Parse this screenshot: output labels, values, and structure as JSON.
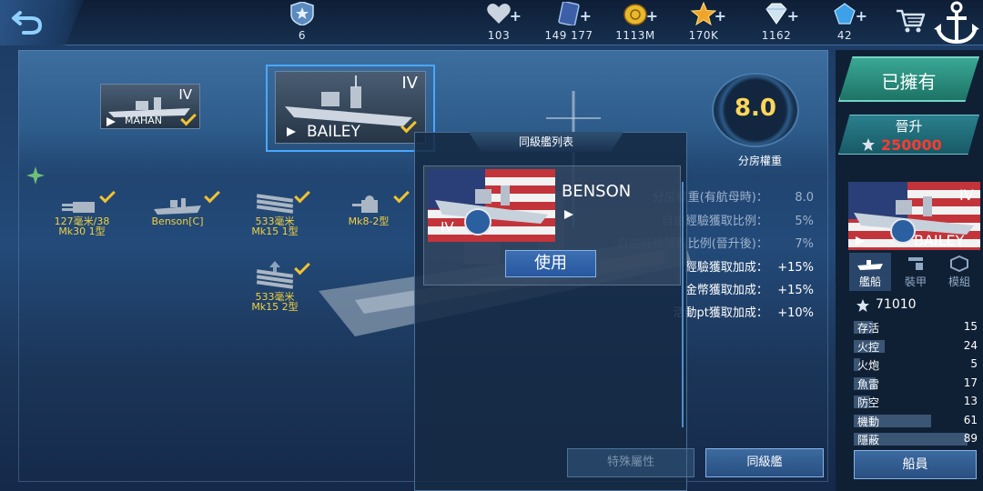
{
  "topbar": {
    "rank": {
      "icon": "rank-badge-icon",
      "value": "6"
    },
    "resources": [
      {
        "icon": "heart-icon",
        "value": "103",
        "color": "#c9d4e0"
      },
      {
        "icon": "card-icon",
        "value": "149 177",
        "color": "#3d5fa8"
      },
      {
        "icon": "gold-coin-icon",
        "value": "1113M",
        "color": "#e8b92c"
      },
      {
        "icon": "star-icon",
        "value": "170K",
        "color": "#f0a52a"
      },
      {
        "icon": "diamond-icon",
        "value": "1162",
        "color": "#cfe3f3"
      },
      {
        "icon": "blue-crystal-icon",
        "value": "42",
        "color": "#3ea0e8"
      }
    ]
  },
  "fleet": {
    "ships": [
      {
        "name": "MAHAN",
        "tier": "IV"
      },
      {
        "name": "BAILEY",
        "tier": "IV"
      }
    ],
    "equipment": [
      {
        "name": "127毫米/38\nMk30 1型"
      },
      {
        "name": "Benson[C]"
      },
      {
        "name": "533毫米\nMk15 1型"
      },
      {
        "name": "Mk8-2型"
      },
      {
        "name": "533毫米\nMk15 2型"
      }
    ]
  },
  "rating": {
    "value": "8.0",
    "label": "分房權重",
    "stats": [
      {
        "label": "分房權重(有航母時)：",
        "value": "8.0",
        "dim": true
      },
      {
        "label": "自由經驗獲取比例：",
        "value": "5%",
        "dim": true
      },
      {
        "label": "自由經驗獲取比例(晉升後)：",
        "value": "7%",
        "dim": true
      },
      {
        "label": "經驗獲取加成：",
        "value": "+15%",
        "dim": false
      },
      {
        "label": "金幣獲取加成：",
        "value": "+15%",
        "dim": false
      },
      {
        "label": "活動pt獲取加成：",
        "value": "+10%",
        "dim": false
      }
    ]
  },
  "modal": {
    "title": "同級艦列表",
    "ship": {
      "name": "BENSON",
      "tier": "IV"
    },
    "use_button": "使用"
  },
  "bottom_buttons": {
    "special": "特殊屬性",
    "same_class": "同級艦"
  },
  "right_panel": {
    "owned": "已擁有",
    "promote_label": "晉升",
    "promote_cost": "250000",
    "ship": {
      "name": "BAILEY",
      "tier": "IV"
    },
    "tabs": [
      {
        "label": "艦船",
        "icon": "ship-icon",
        "active": true
      },
      {
        "label": "裝甲",
        "icon": "armor-icon",
        "active": false
      },
      {
        "label": "模組",
        "icon": "module-icon",
        "active": false
      }
    ],
    "score": "71010",
    "stats": [
      {
        "label": "存活",
        "value": 15
      },
      {
        "label": "火控",
        "value": 24
      },
      {
        "label": "火炮",
        "value": 5
      },
      {
        "label": "魚雷",
        "value": 17
      },
      {
        "label": "防空",
        "value": 13
      },
      {
        "label": "機動",
        "value": 61
      },
      {
        "label": "隱蔽",
        "value": 89
      }
    ],
    "crew_button": "船員"
  }
}
